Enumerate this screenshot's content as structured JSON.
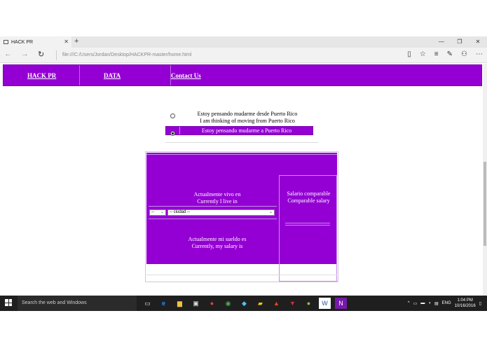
{
  "browser": {
    "tab_title": "HACK PR",
    "close_tab": "✕",
    "new_tab": "+",
    "minimize": "—",
    "maximize": "❐",
    "close_window": "✕",
    "url": "file:///C:/Users/Jordan/Desktop/HACKPR-master/home.html"
  },
  "nav": {
    "items": [
      "HACK PR",
      "DATA",
      "Contact Us"
    ]
  },
  "choices": {
    "option1_es": "Estoy pensando mudarme desde Puerto Rico",
    "option1_en": "I am thinking of moving from Puerto Rico",
    "option2": "Estoy pensando mudarme a Puerto Rico",
    "selected": "option2"
  },
  "panel": {
    "live_es": "Actualmente vivo en",
    "live_en": "Currently I live in",
    "state_select": "--",
    "city_select": "-- ciudad --",
    "salary_es": "Actualmente mi sueldo es",
    "salary_en": "Currently, my salary is",
    "comparable_es": "Salario comparable",
    "comparable_en": "Comparable salary"
  },
  "taskbar": {
    "search_placeholder": "Search the web and Windows",
    "lang": "ENG",
    "time": "1:04 PM",
    "date": "10/16/2016"
  },
  "colors": {
    "accent": "#9400d3",
    "taskbar": "#1f1f1f"
  },
  "icons": [
    "back-icon",
    "forward-icon",
    "refresh-icon",
    "reading-view-icon",
    "favorite-icon",
    "hub-icon",
    "web-note-icon",
    "share-icon",
    "more-icon"
  ]
}
